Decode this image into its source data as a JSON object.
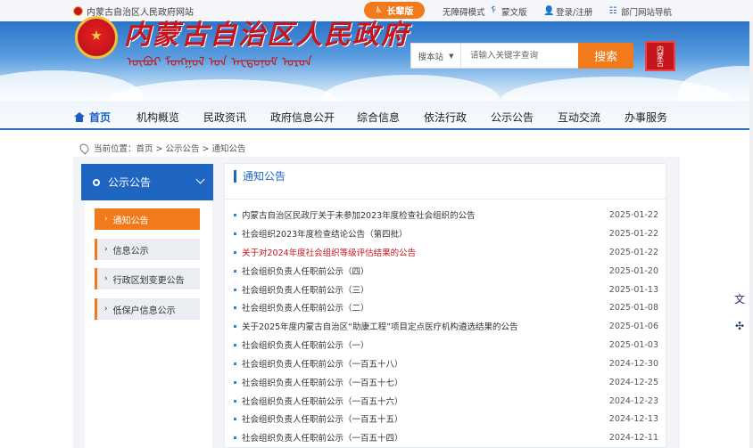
{
  "topbar": {
    "site_name": "内蒙古自治区人民政府网站",
    "elder_mode": "长辈版",
    "accessibility": "无障碍模式",
    "mongolian": "蒙文版",
    "login": "登录/注册",
    "dept_nav": "部门网站导航"
  },
  "banner": {
    "title": "内蒙古自治区人民政府",
    "mongolian_script": "ᠥᠪᠦᠷ ᠮᠣᠩᠭᠣᠯ ᠤᠨ ᠠᠸᠲᠣᠨᠣᠮ ᠣᠷᠣᠨ",
    "seal_text": "内蒙古"
  },
  "search": {
    "scope": "搜本站",
    "placeholder": "请输入关键字查询",
    "button": "搜索"
  },
  "nav": {
    "items": [
      "首页",
      "机构概览",
      "民政资讯",
      "政府信息公开",
      "综合信息",
      "依法行政",
      "公示公告",
      "互动交流",
      "办事服务"
    ]
  },
  "breadcrumb": {
    "prefix": "当前位置：",
    "path": "首页 > 公示公告 > 通知公告"
  },
  "sidebar": {
    "title": "公示公告",
    "items": [
      "通知公告",
      "信息公示",
      "行政区划变更公告",
      "低保户信息公示"
    ]
  },
  "main": {
    "title": "通知公告",
    "rows": [
      {
        "title": "内蒙古自治区民政厅关于未参加2023年度检查社会组织的公告",
        "date": "2025-01-22"
      },
      {
        "title": "社会组织2023年度检查结论公告（第四批）",
        "date": "2025-01-22"
      },
      {
        "title": "关于对2024年度社会组织等级评估结果的公告",
        "date": "2025-01-22",
        "highlight": true
      },
      {
        "title": "社会组织负责人任职前公示（四）",
        "date": "2025-01-20"
      },
      {
        "title": "社会组织负责人任职前公示（三）",
        "date": "2025-01-13"
      },
      {
        "title": "社会组织负责人任职前公示（二）",
        "date": "2025-01-08"
      },
      {
        "title": "关于2025年度内蒙古自治区“助康工程”项目定点医疗机构遴选结果的公告",
        "date": "2025-01-06"
      },
      {
        "title": "社会组织负责人任职前公示（一）",
        "date": "2025-01-03"
      },
      {
        "title": "社会组织负责人任职前公示（一百五十八）",
        "date": "2024-12-30"
      },
      {
        "title": "社会组织负责人任职前公示（一百五十七）",
        "date": "2024-12-25"
      },
      {
        "title": "社会组织负责人任职前公示（一百五十六）",
        "date": "2024-12-23"
      },
      {
        "title": "社会组织负责人任职前公示（一百五十五）",
        "date": "2024-12-13"
      },
      {
        "title": "社会组织负责人任职前公示（一百五十四）",
        "date": "2024-12-11"
      }
    ]
  },
  "floating": {
    "translate_icon": "translate-icon",
    "share_icon": "network-icon"
  },
  "colors": {
    "brand_blue": "#1f66c2",
    "accent_orange": "#f07a1c",
    "title_red": "#c5161d"
  }
}
